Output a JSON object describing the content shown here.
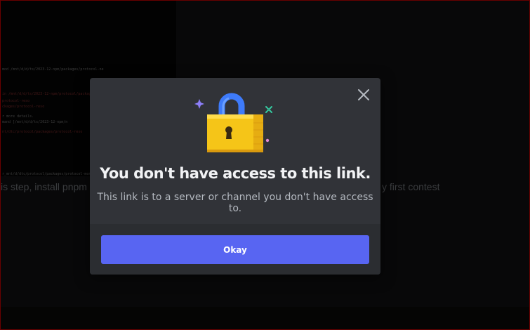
{
  "background": {
    "terminal_lines": [
      {
        "text": "mod /mnt/d/d/ts/2023-12-npm/packages/protocol-ne",
        "color": "gray"
      },
      {
        "text": "in /mnt/d/d/ts/2023-12-npm/protocol/packages/protocol",
        "color": "red"
      },
      {
        "text": "protocol-reso",
        "color": "red"
      },
      {
        "text": "ckages/protocol-reso",
        "color": "red"
      },
      {
        "text": "r more details.",
        "color": "gray"
      },
      {
        "text": "mand [/mnt/d/d/ts/2023-12-npm/n",
        "color": "gray"
      },
      {
        "text": "nt/dtc/protocol/packages/protocol-reso",
        "color": "red"
      },
      {
        "text": "r_mnt/d/dtc/protocol/packages/protocol-mon",
        "color": "gray"
      }
    ],
    "left_text": "is step, install pnpm",
    "right_text": "y first contest"
  },
  "modal": {
    "title": "You don't have access to this link.",
    "subtitle": "This link is to a server or channel you don't have access to.",
    "okay_label": "Okay",
    "close_icon": "close-icon",
    "illustration": "padlock-icon",
    "colors": {
      "modal_bg": "#313338",
      "footer_bg": "#2b2d31",
      "button_bg": "#5865f2",
      "lock_body": "#f5c518",
      "lock_shackle": "#3e7bfa"
    }
  }
}
